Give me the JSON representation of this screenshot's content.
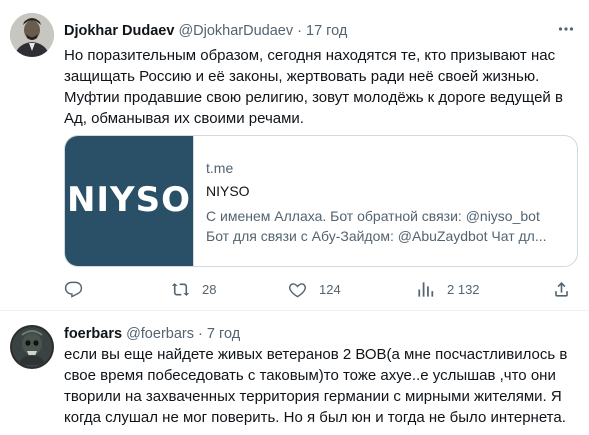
{
  "tweets": [
    {
      "author_name": "Djokhar Dudaev",
      "handle": "@DjokharDudaev",
      "time": "17 год",
      "text_lines": [
        "Но поразительным образом, сегодня находятся те, кто призывают нас",
        "защищать Россию и её законы, жертвовать ради неё своей жизнью.",
        "Муфтии продавшие свою религию, зовут молодёжь к дороге ведущей в",
        "Ад, обманывая их своими речами."
      ],
      "card": {
        "logo_text": "NIYSO",
        "domain": "t.me",
        "title": "NIYSO",
        "desc_line1": "С именем Аллаха. Бот обратной связи: @niyso_bot",
        "desc_line2": "Бот для связи с Абу-Зайдом: @AbuZaydbot Чат дл..."
      },
      "actions": {
        "reply": "",
        "retweet": "28",
        "like": "124",
        "views": "2 132",
        "share": ""
      },
      "icons": {
        "more": "more-icon",
        "reply": "reply-icon",
        "retweet": "retweet-icon",
        "like": "heart-icon",
        "views": "views-icon",
        "share": "share-icon"
      }
    },
    {
      "author_name": "foerbars",
      "handle": "@foerbars",
      "time": "7 год",
      "text_lines": [
        "если вы еще найдете живых ветеранов 2 ВОВ(а мне посчастливилось в",
        "свое время побеседовать с таковым)то тоже ахуе..е услышав ,что они",
        "творили на захваченных территория германии с мирными жителями. Я",
        "когда слушал не мог поверить. Но я был юн и тогда не было интернета."
      ]
    }
  ],
  "colors": {
    "text": "#0f1419",
    "secondary": "#536471",
    "border": "#cfd9de",
    "card_image_bg": "#295067"
  }
}
